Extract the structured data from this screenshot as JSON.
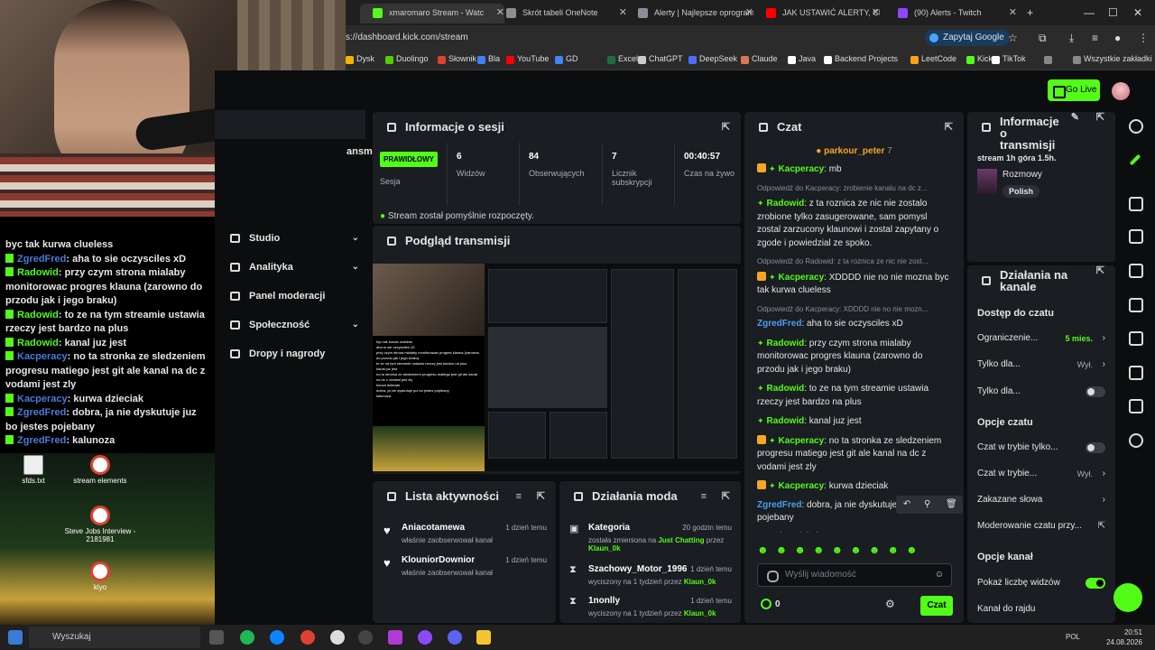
{
  "browser": {
    "tabs": [
      {
        "label": "xmaromaro Stream - Watc",
        "color": "#53fc18"
      },
      {
        "label": "Skrót tabeli OneNote",
        "color": "#8a8f96"
      },
      {
        "label": "Alerty | Najlepsze oprogram",
        "color": "#8a8f96"
      },
      {
        "label": "JAK USTAWIĆ ALERTY, CHA",
        "color": "#ff0000"
      },
      {
        "label": "(90) Alerts - Twitch",
        "color": "#9146ff"
      }
    ],
    "new_tab": "+",
    "url": "s://dashboard.kick.com/stream",
    "ask_google": "Zapytaj Google",
    "bookmarks": [
      {
        "label": "Dysk",
        "color": "#f4b400"
      },
      {
        "label": "Duolingo",
        "color": "#58cc02"
      },
      {
        "label": "Słownik",
        "color": "#e04030"
      },
      {
        "label": "Bla",
        "color": "#3b82f6"
      },
      {
        "label": "YouTube",
        "color": "#ff0000"
      },
      {
        "label": "GD",
        "color": "#4285f4"
      },
      {
        "label": "Excel",
        "color": "#1d6f42"
      },
      {
        "label": "ChatGPT",
        "color": "#cccccc"
      },
      {
        "label": "DeepSeek",
        "color": "#4d6bfe"
      },
      {
        "label": "Claude",
        "color": "#d97757"
      },
      {
        "label": "Java",
        "color": "#ffffff"
      },
      {
        "label": "Backend Projects",
        "color": "#ffffff"
      },
      {
        "label": "LeetCode",
        "color": "#ffa116"
      },
      {
        "label": "Kick",
        "color": "#53fc18"
      },
      {
        "label": "TikTok",
        "color": "#ffffff"
      }
    ],
    "all_bookmarks": "Wszystkie zakładki"
  },
  "overlay_chat": [
    {
      "user": "",
      "text": "byc tak kurwa clueless",
      "color": ""
    },
    {
      "user": "ZgredFred",
      "text": "aha to sie oczysciles xD",
      "color": "blue"
    },
    {
      "user": "Radowid",
      "text": "przy czym strona mialaby monitorowac progres klauna (zarowno do przodu jak i jego braku)",
      "color": "green"
    },
    {
      "user": "Radowid",
      "text": "to ze na tym streamie ustawia rzeczy jest bardzo na plus",
      "color": "green"
    },
    {
      "user": "Radowid",
      "text": "kanal juz jest",
      "color": "green"
    },
    {
      "user": "Kacperacy",
      "text": "no ta stronka ze sledzeniem progresu matiego jest git ale kanal na dc z vodami jest zly",
      "color": "blue"
    },
    {
      "user": "Kacperacy",
      "text": "kurwa dzieciak",
      "color": "blue"
    },
    {
      "user": "ZgredFred",
      "text": "dobra, ja nie dyskutuje juz bo jestes pojebany",
      "color": "blue"
    },
    {
      "user": "ZgredFred",
      "text": "kalunoza",
      "color": "blue"
    }
  ],
  "desktop_icons": [
    {
      "label": "sfds.txt"
    },
    {
      "label": "stream elements"
    },
    {
      "label": "Steve Jobs Interview - 2181981"
    },
    {
      "label": "kiyo"
    }
  ],
  "header": {
    "go_live": "Go Live"
  },
  "left_nav": {
    "partial": "ansmi",
    "items": [
      {
        "label": "Studio",
        "chevron": "⌄"
      },
      {
        "label": "Analityka",
        "chevron": "⌄"
      },
      {
        "label": "Panel moderacji",
        "chevron": ""
      },
      {
        "label": "Społeczność",
        "chevron": "⌄"
      },
      {
        "label": "Dropy i nagrody",
        "chevron": ""
      }
    ]
  },
  "session": {
    "title": "Informacje o sesji",
    "badge": "PRAWIDŁOWY",
    "badge_sub": "Sesja",
    "stats": [
      {
        "value": "6",
        "label": "Widzów"
      },
      {
        "value": "84",
        "label": "Obserwujących"
      },
      {
        "value": "7",
        "label": "Licznik subskrypcji"
      },
      {
        "value": "00:40:57",
        "label": "Czas na żywo"
      }
    ],
    "status": "Stream został pomyślnie rozpoczęty."
  },
  "preview": {
    "title": "Podgląd transmisji"
  },
  "activity": {
    "title": "Lista aktywności",
    "items": [
      {
        "name": "Aniacotamewa",
        "desc": "właśnie zaobserwował kanał",
        "time": "1 dzień temu"
      },
      {
        "name": "KlouniorDownior",
        "desc": "właśnie zaobserwował kanał",
        "time": "1 dzień temu"
      }
    ]
  },
  "mod_actions": {
    "title": "Działania moda",
    "items": [
      {
        "name": "Kategoria",
        "desc_pre": "została zmieniona na",
        "hl1": "Just Chatting",
        "desc_mid": "przez",
        "hl2": "Klaun_0k",
        "time": "20 godzin temu"
      },
      {
        "name": "Szachowy_Motor_1996",
        "desc_pre": "wyciszony na 1 tydzień przez",
        "hl1": "Klaun_0k",
        "desc_mid": "",
        "hl2": "",
        "time": "1 dzień temu"
      },
      {
        "name": "1nonlly",
        "desc_pre": "wyciszony na 1 tydzień przez",
        "hl1": "Klaun_0k",
        "desc_mid": "",
        "hl2": "",
        "time": "1 dzień temu"
      }
    ]
  },
  "chat": {
    "title": "Czat",
    "pinned_user": "parkour_peter",
    "pinned_count": "7",
    "messages": [
      {
        "reply": "",
        "user": "Kacperacy",
        "text": "mb",
        "color": "green",
        "badges": true
      },
      {
        "reply": "Odpowiedź do Kacperacy: zrobienie kanalu na dc z...",
        "user": "Radowid",
        "text": "z ta roznica ze nic nie zostalo zrobione tylko zasugerowane, sam pomysl zostal zarzucony klaunowi i zostal zapytany o zgode i powiedzial ze spoko.",
        "color": "green",
        "badges": false
      },
      {
        "reply": "Odpowiedź do Radowid: z ta roznica ze nic nie zost...",
        "user": "Kacperacy",
        "text": "XDDDD nie no nie mozna byc tak kurwa clueless",
        "color": "green",
        "badges": true
      },
      {
        "reply": "Odpowiedź do Kacperacy: XDDDD nie no nie mozn...",
        "user": "ZgredFred",
        "text": "aha to sie oczysciles xD",
        "color": "blue",
        "badges": false
      },
      {
        "reply": "",
        "user": "Radowid",
        "text": "przy czym strona mialaby monitorowac progres klauna (zarowno do przodu jak i jego braku)",
        "color": "green",
        "badges": false
      },
      {
        "reply": "",
        "user": "Radowid",
        "text": "to ze na tym streamie ustawia rzeczy jest bardzo na plus",
        "color": "green",
        "badges": false
      },
      {
        "reply": "",
        "user": "Radowid",
        "text": "kanal juz jest",
        "color": "green",
        "badges": false
      },
      {
        "reply": "",
        "user": "Kacperacy",
        "text": "no ta stronka ze sledzeniem progresu matiego jest git ale kanal na dc z vodami jest zly",
        "color": "green",
        "badges": true
      },
      {
        "reply": "",
        "user": "Kacperacy",
        "text": "kurwa dzieciak",
        "color": "green",
        "badges": true
      },
      {
        "reply": "",
        "user": "ZgredFred",
        "text": "dobra, ja nie dyskutuje juz bo jestes pojebany",
        "color": "blue",
        "badges": false
      },
      {
        "reply": "",
        "user": "ZgredFred",
        "text": "kalunoza",
        "color": "blue",
        "badges": false
      }
    ],
    "placeholder": "Wyślij wiadomość",
    "viewer_count": "0",
    "send": "Czat"
  },
  "info": {
    "title": "Informacje o transmisji",
    "stream_title": "stream 1h góra 1.5h.",
    "category": "Rozmowy",
    "tag": "Polish"
  },
  "channel_actions": {
    "title": "Działania na kanale",
    "access_title": "Dostęp do czatu",
    "restrict": {
      "label": "Ograniczenie...",
      "value": "5 mies."
    },
    "only_for_1": {
      "label": "Tylko dla...",
      "value": "Wył."
    },
    "only_for_2": {
      "label": "Tylko dla..."
    },
    "chat_options_title": "Opcje czatu",
    "mode_only": {
      "label": "Czat w trybie tylko..."
    },
    "mode": {
      "label": "Czat w trybie...",
      "value": "Wył."
    },
    "banned_words": {
      "label": "Zakazane słowa"
    },
    "moderation": {
      "label": "Moderowanie czatu przy..."
    },
    "channel_options_title": "Opcje kanał",
    "show_viewers": {
      "label": "Pokaż liczbę widzów"
    },
    "raid": {
      "label": "Kanał do rajdu"
    }
  },
  "taskbar": {
    "search": "Wyszukaj",
    "lang": "POL",
    "time": "20:51",
    "date": "24.08.2026"
  }
}
